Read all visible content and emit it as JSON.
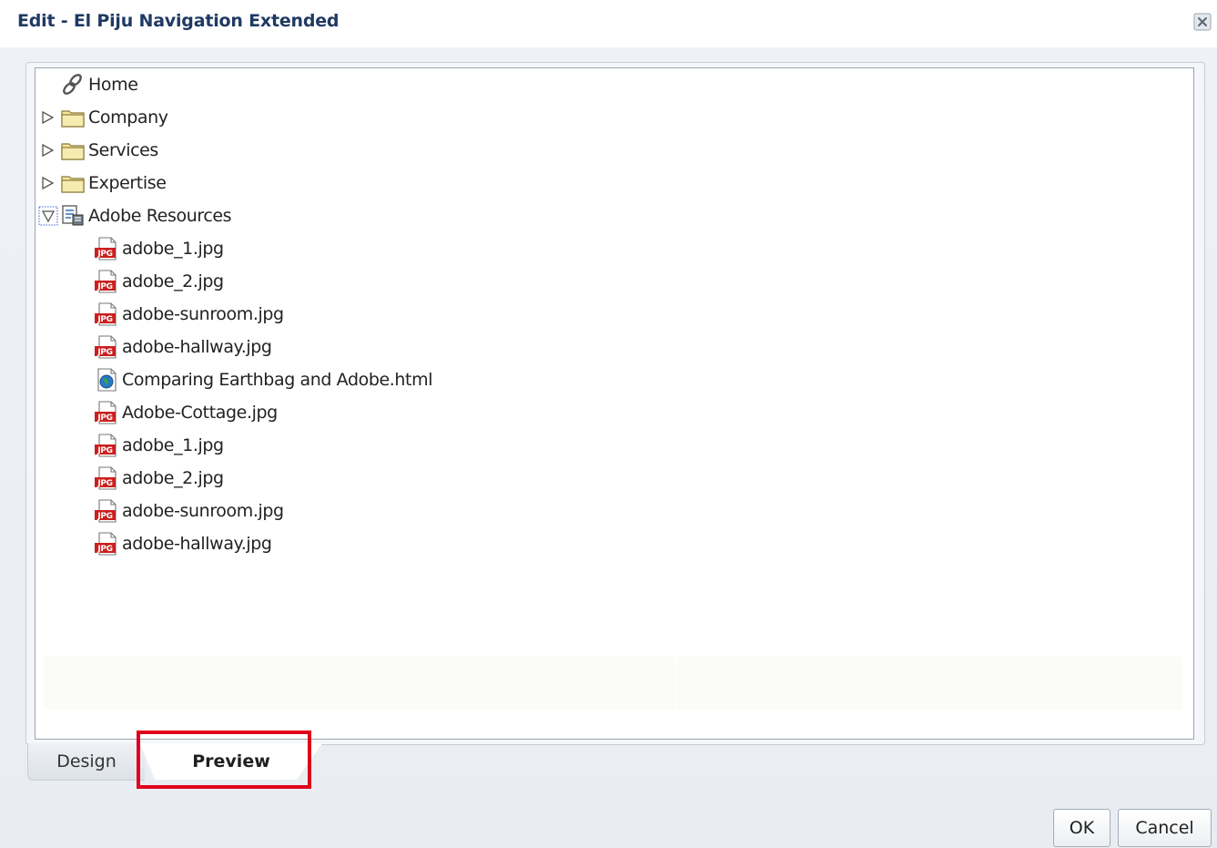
{
  "dialog": {
    "title": "Edit - El Piju Navigation Extended",
    "close_icon": "close-icon"
  },
  "tree": {
    "nodes": [
      {
        "label": "Home",
        "icon": "link-icon",
        "expander": "none"
      },
      {
        "label": "Company",
        "icon": "folder-icon",
        "expander": "collapsed"
      },
      {
        "label": "Services",
        "icon": "folder-icon",
        "expander": "collapsed"
      },
      {
        "label": "Expertise",
        "icon": "folder-icon",
        "expander": "collapsed"
      },
      {
        "label": "Adobe Resources",
        "icon": "resource-list-icon",
        "expander": "expanded"
      },
      {
        "label": "adobe_1.jpg",
        "icon": "jpg-file-icon",
        "expander": "none"
      },
      {
        "label": "adobe_2.jpg",
        "icon": "jpg-file-icon",
        "expander": "none"
      },
      {
        "label": "adobe-sunroom.jpg",
        "icon": "jpg-file-icon",
        "expander": "none"
      },
      {
        "label": "adobe-hallway.jpg",
        "icon": "jpg-file-icon",
        "expander": "none"
      },
      {
        "label": "Comparing Earthbag and Adobe.html",
        "icon": "html-file-icon",
        "expander": "none"
      },
      {
        "label": "Adobe-Cottage.jpg",
        "icon": "jpg-file-icon",
        "expander": "none"
      },
      {
        "label": "adobe_1.jpg",
        "icon": "jpg-file-icon",
        "expander": "none"
      },
      {
        "label": "adobe_2.jpg",
        "icon": "jpg-file-icon",
        "expander": "none"
      },
      {
        "label": "adobe-sunroom.jpg",
        "icon": "jpg-file-icon",
        "expander": "none"
      },
      {
        "label": "adobe-hallway.jpg",
        "icon": "jpg-file-icon",
        "expander": "none"
      }
    ]
  },
  "tabs": {
    "design_label": "Design",
    "preview_label": "Preview",
    "selected": "Preview"
  },
  "buttons": {
    "ok_label": "OK",
    "cancel_label": "Cancel"
  },
  "colors": {
    "title": "#1f3a63",
    "highlight": "#e0001b",
    "jpg_icon": "#cc1f1f",
    "folder": "#f3e59a"
  }
}
